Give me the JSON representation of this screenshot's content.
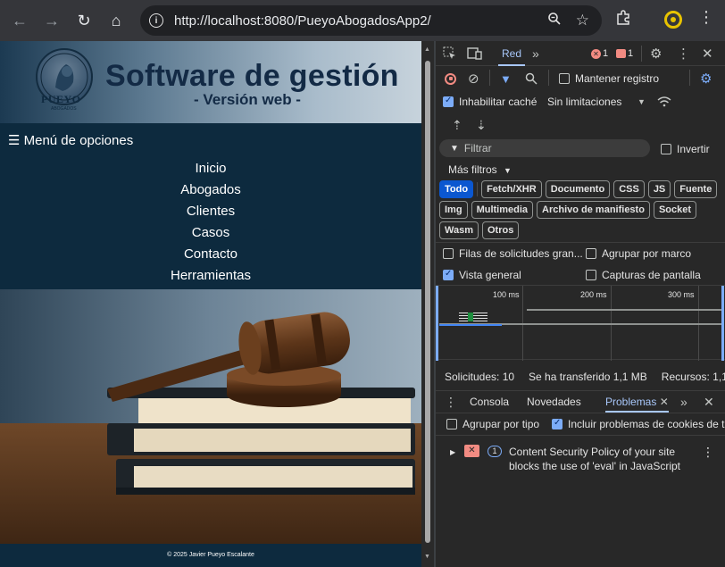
{
  "browser": {
    "url": "http://localhost:8080/PueyoAbogadosApp2/"
  },
  "site": {
    "logo_text": "PUEYO",
    "logo_sub": "ABOGADOS",
    "title": "Software de gestión",
    "subtitle": "- Versión web -",
    "menu_toggle": "☰ Menú de opciones",
    "menu_items": [
      "Inicio",
      "Abogados",
      "Clientes",
      "Casos",
      "Contacto",
      "Herramientas"
    ],
    "footer": "© 2025 Javier Pueyo Escalante"
  },
  "devtools": {
    "active_tab": "Red",
    "error_count": "1",
    "warning_count": "1",
    "preserve_log": "Mantener registro",
    "disable_cache": "Inhabilitar caché",
    "throttling": "Sin limitaciones",
    "filter_placeholder": "Filtrar",
    "invert": "Invertir",
    "more_filters": "Más filtros",
    "type_filters": [
      "Todo",
      "Fetch/XHR",
      "Documento",
      "CSS",
      "JS",
      "Fuente",
      "Img",
      "Multimedia",
      "Archivo de manifiesto",
      "Socket",
      "Wasm",
      "Otros"
    ],
    "option_big_rows": "Filas de solicitudes gran...",
    "option_group_frame": "Agrupar por marco",
    "option_overview": "Vista general",
    "option_screenshots": "Capturas de pantalla",
    "timeline_ticks": [
      "100 ms",
      "200 ms",
      "300 ms"
    ],
    "status_requests": "Solicitudes: 10",
    "status_transferred": "Se ha transferido 1,1 MB",
    "status_resources": "Recursos: 1,1",
    "drawer_tabs": [
      "Consola",
      "Novedades",
      "Problemas"
    ],
    "drawer_active": "Problemas",
    "group_by_type": "Agrupar por tipo",
    "include_cookies": "Incluir problemas de cookies de t",
    "issue_count": "1",
    "issue_text_line1": "Content Security Policy of your site",
    "issue_text_line2": "blocks the use of 'eval' in JavaScript"
  }
}
